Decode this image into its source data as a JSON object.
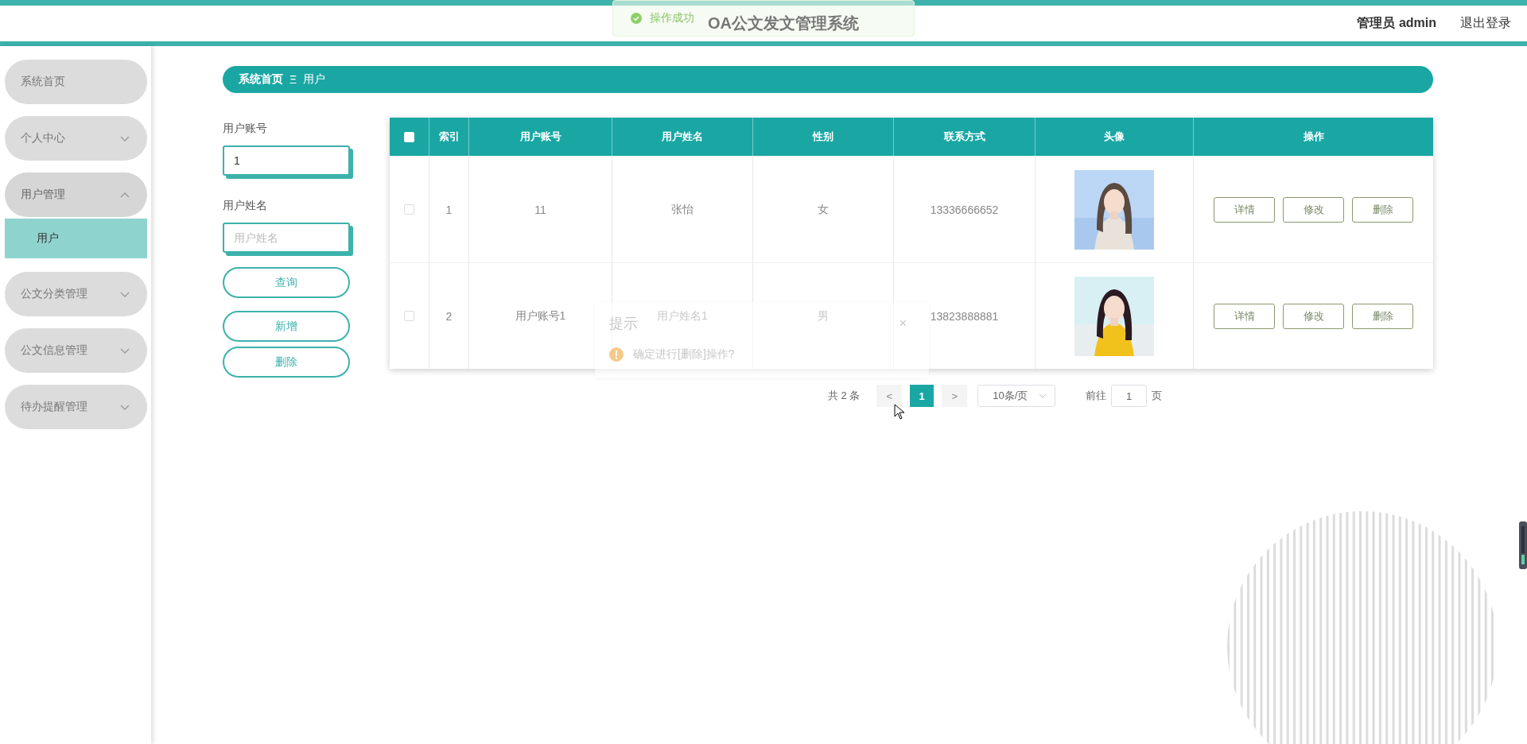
{
  "header": {
    "title": "OA公文发文管理系统",
    "user": "管理员 admin",
    "logout": "退出登录"
  },
  "toast": {
    "kind": "success",
    "text": "操作成功"
  },
  "sidebar": {
    "items": [
      {
        "label": "系统首页"
      },
      {
        "label": "个人中心",
        "expanded": false
      },
      {
        "label": "用户管理",
        "expanded": true,
        "children": [
          {
            "label": "用户",
            "selected": true
          }
        ]
      },
      {
        "label": "公文分类管理",
        "expanded": false
      },
      {
        "label": "公文信息管理",
        "expanded": false
      },
      {
        "label": "待办提醒管理",
        "expanded": false
      }
    ]
  },
  "breadcrumb": {
    "items": [
      "系统首页",
      "用户"
    ],
    "separator": "Ξ"
  },
  "search": {
    "fields": [
      {
        "label": "用户账号",
        "value": "1"
      },
      {
        "label": "用户姓名",
        "placeholder": "用户姓名"
      }
    ],
    "buttons": [
      "查询",
      "新增",
      "删除"
    ]
  },
  "table": {
    "header_checked": false,
    "columns": [
      "索引",
      "用户账号",
      "用户姓名",
      "性别",
      "联系方式",
      "头像",
      "操作"
    ],
    "rows": [
      {
        "checked": false,
        "index": "1",
        "account": "11",
        "name": "张怡",
        "sex": "女",
        "phone": "13336666652",
        "actions": [
          "详情",
          "修改",
          "删除"
        ]
      },
      {
        "checked": false,
        "index": "2",
        "account": "用户账号1",
        "name": "用户姓名1",
        "sex": "男",
        "phone": "13823888881",
        "actions": [
          "详情",
          "修改",
          "删除"
        ]
      }
    ]
  },
  "pagination": {
    "total": "共 2 条",
    "prev": "<",
    "pages": [
      {
        "label": "1",
        "selected": true
      }
    ],
    "next": ">",
    "page_size": "10条/页",
    "goto_label": "前往",
    "goto_value": "1",
    "goto_suffix": "页"
  },
  "dialog": {
    "title": "提示",
    "close": "×",
    "message": "确定进行[删除]操作?"
  }
}
